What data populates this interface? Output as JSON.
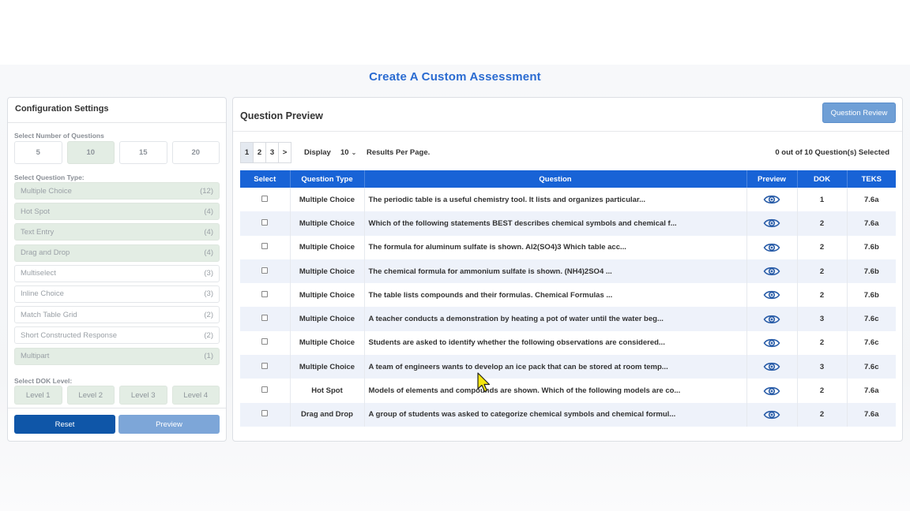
{
  "page": {
    "title": "Create A Custom Assessment"
  },
  "config": {
    "title": "Configuration Settings",
    "num_questions_label": "Select Number of Questions",
    "num_options": [
      {
        "label": "5",
        "selected": false
      },
      {
        "label": "10",
        "selected": true
      },
      {
        "label": "15",
        "selected": false
      },
      {
        "label": "20",
        "selected": false
      }
    ],
    "question_type_label": "Select Question Type:",
    "question_types": [
      {
        "label": "Multiple Choice",
        "count": "(12)",
        "selected": true
      },
      {
        "label": "Hot Spot",
        "count": "(4)",
        "selected": true
      },
      {
        "label": "Text Entry",
        "count": "(4)",
        "selected": true
      },
      {
        "label": "Drag and Drop",
        "count": "(4)",
        "selected": true
      },
      {
        "label": "Multiselect",
        "count": "(3)",
        "selected": false
      },
      {
        "label": "Inline Choice",
        "count": "(3)",
        "selected": false
      },
      {
        "label": "Match Table Grid",
        "count": "(2)",
        "selected": false
      },
      {
        "label": "Short Constructed Response",
        "count": "(2)",
        "selected": false
      },
      {
        "label": "Multipart",
        "count": "(1)",
        "selected": true
      }
    ],
    "dok_label": "Select DOK Level:",
    "dok_levels": [
      "Level 1",
      "Level 2",
      "Level 3",
      "Level 4"
    ],
    "reset_label": "Reset",
    "preview_label": "Preview"
  },
  "preview": {
    "title": "Question Preview",
    "review_button": "Question Review",
    "pages": [
      "1",
      "2",
      "3",
      ">"
    ],
    "display_label": "Display",
    "display_value": "10",
    "results_label": "Results Per Page.",
    "selected_count": "0 out of 10 Question(s) Selected",
    "columns": [
      "Select",
      "Question Type",
      "Question",
      "Preview",
      "DOK",
      "TEKS"
    ],
    "rows": [
      {
        "type": "Multiple Choice",
        "question": "The periodic table is a useful chemistry tool. It lists and organizes particular...",
        "dok": "1",
        "teks": "7.6a"
      },
      {
        "type": "Multiple Choice",
        "question": "Which of the following statements BEST describes chemical symbols and chemical f...",
        "dok": "2",
        "teks": "7.6a"
      },
      {
        "type": "Multiple Choice",
        "question": "The formula for aluminum sulfate is shown. Al2(SO4)3 Which table acc...",
        "dok": "2",
        "teks": "7.6b"
      },
      {
        "type": "Multiple Choice",
        "question": "The chemical formula for ammonium sulfate is shown. (NH4)2SO4 ...",
        "dok": "2",
        "teks": "7.6b"
      },
      {
        "type": "Multiple Choice",
        "question": "The table lists compounds and their formulas. Chemical Formulas ...",
        "dok": "2",
        "teks": "7.6b"
      },
      {
        "type": "Multiple Choice",
        "question": "A teacher conducts a demonstration by heating a pot of water until the water beg...",
        "dok": "3",
        "teks": "7.6c"
      },
      {
        "type": "Multiple Choice",
        "question": "Students are asked to identify whether the following observations are considered...",
        "dok": "2",
        "teks": "7.6c"
      },
      {
        "type": "Multiple Choice",
        "question": "A team of engineers wants to develop an ice pack that can be stored at room temp...",
        "dok": "3",
        "teks": "7.6c"
      },
      {
        "type": "Hot Spot",
        "question": "Models of elements and compounds are shown. Which of the following models are co...",
        "dok": "2",
        "teks": "7.6a"
      },
      {
        "type": "Drag and Drop",
        "question": "A group of students was asked to categorize chemical symbols and chemical formul...",
        "dok": "2",
        "teks": "7.6a"
      }
    ]
  },
  "colors": {
    "accent": "#2a6bd1",
    "header_blue": "#1863d6",
    "selected_green": "#e3ede4",
    "reset_blue": "#0f56a8"
  }
}
